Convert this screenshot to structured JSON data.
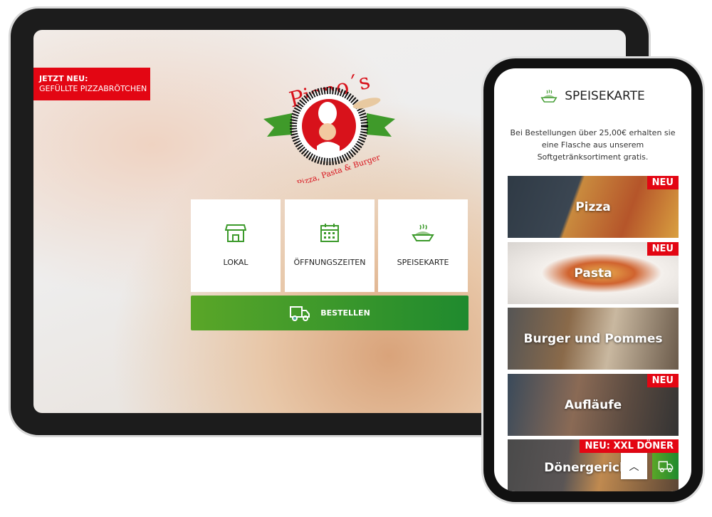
{
  "tablet": {
    "banner": {
      "line1": "JETZT NEU:",
      "line2": "GEFÜLLTE PIZZABRÖTCHEN"
    },
    "logo": {
      "name": "Piano´s",
      "tagline": "Pizza, Pasta & Burger"
    },
    "tiles": [
      {
        "label": "LOKAL",
        "icon": "store-icon"
      },
      {
        "label": "ÖFFNUNGSZEITEN",
        "icon": "calendar-icon"
      },
      {
        "label": "SPEISEKARTE",
        "icon": "food-bowl-icon"
      }
    ],
    "order_label": "BESTELLEN"
  },
  "phone": {
    "title": "SPEISEKARTE",
    "info": "Bei Bestellungen über 25,00€ erhalten sie eine Flasche aus unserem Softgetränksortiment gratis.",
    "cards": [
      {
        "label": "Pizza",
        "badge": "NEU"
      },
      {
        "label": "Pasta",
        "badge": "NEU"
      },
      {
        "label": "Burger und Pommes"
      },
      {
        "label": "Aufläufe",
        "badge": "NEU"
      },
      {
        "label": "Dönergerichte",
        "badge": "NEU: XXL DÖNER"
      }
    ]
  },
  "colors": {
    "red": "#e30613",
    "green": "#3c9a2b"
  }
}
